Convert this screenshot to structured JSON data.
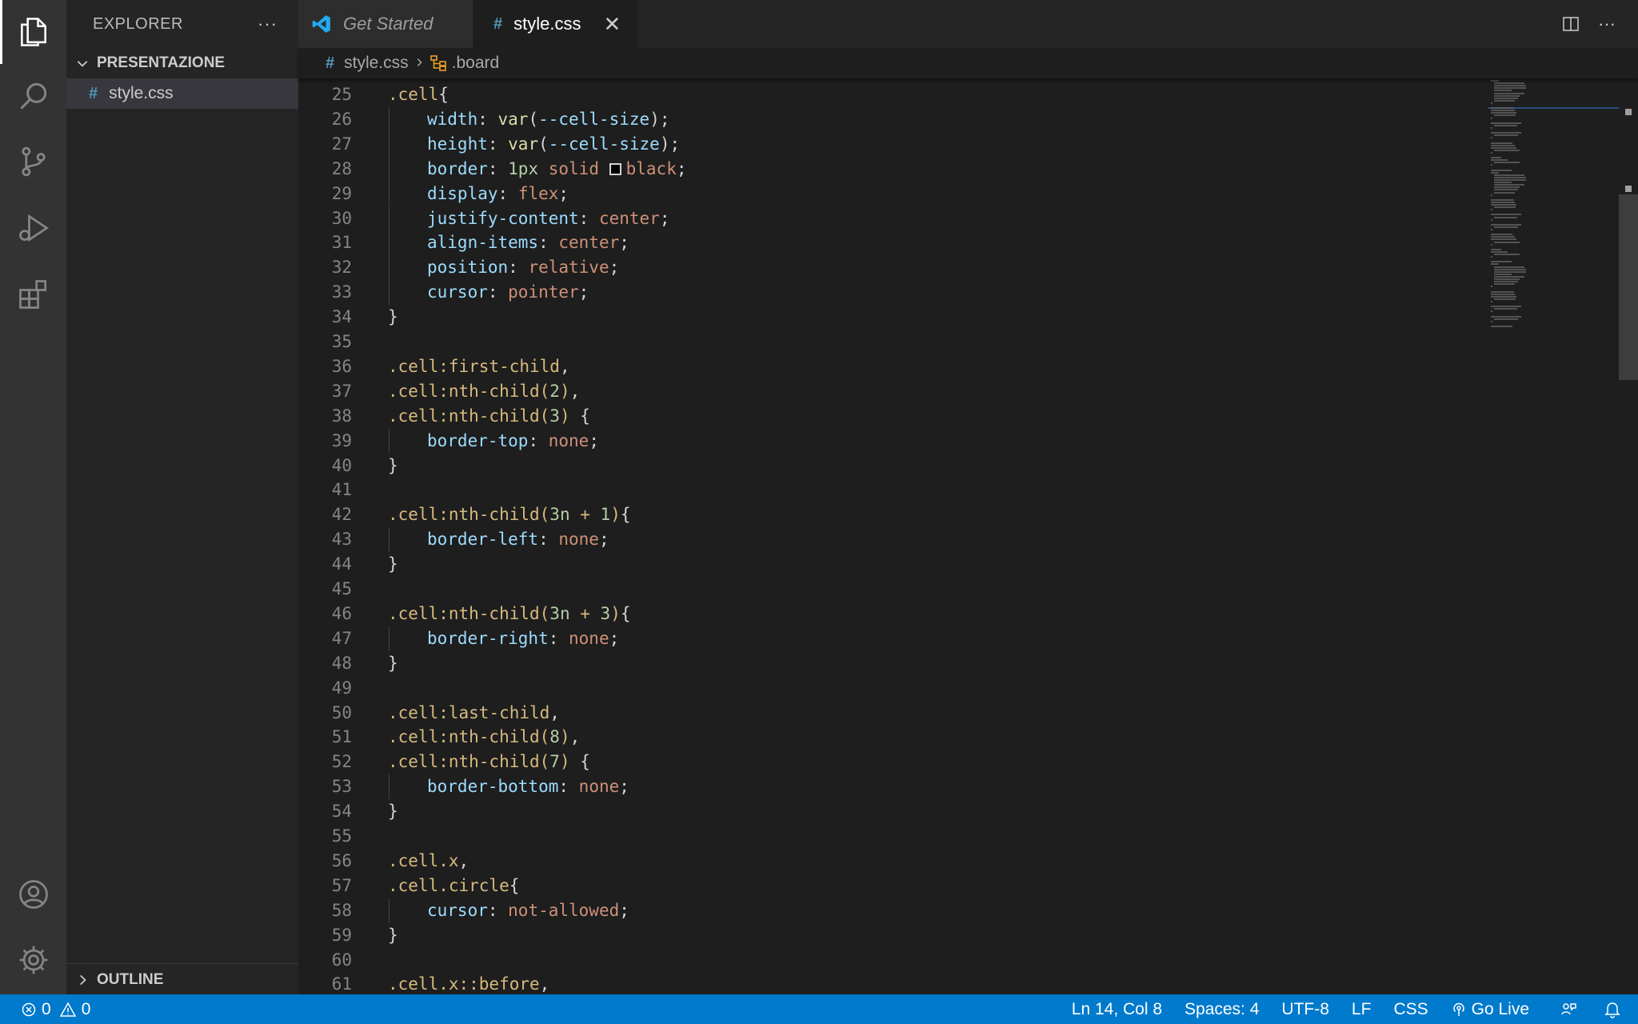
{
  "sidebar": {
    "title": "EXPLORER",
    "more": "···",
    "section": "PRESENTAZIONE",
    "file": "style.css",
    "outline": "OUTLINE"
  },
  "tabs": [
    {
      "label": "Get Started"
    },
    {
      "label": "style.css"
    }
  ],
  "tab_actions": {
    "more": "···"
  },
  "breadcrumb": {
    "file": "style.css",
    "symbol": ".board"
  },
  "editor": {
    "lines": [
      {
        "n": "25",
        "indent": 0,
        "tokens": [
          [
            "sel",
            ".cell"
          ],
          [
            "p",
            "{"
          ]
        ]
      },
      {
        "n": "26",
        "indent": 1,
        "tokens": [
          [
            "prop",
            "width"
          ],
          [
            "p",
            ": "
          ],
          [
            "fn",
            "var"
          ],
          [
            "p",
            "("
          ],
          [
            "var",
            "--cell-size"
          ],
          [
            "p",
            ");"
          ]
        ]
      },
      {
        "n": "27",
        "indent": 1,
        "tokens": [
          [
            "prop",
            "height"
          ],
          [
            "p",
            ": "
          ],
          [
            "fn",
            "var"
          ],
          [
            "p",
            "("
          ],
          [
            "var",
            "--cell-size"
          ],
          [
            "p",
            ");"
          ]
        ]
      },
      {
        "n": "28",
        "indent": 1,
        "tokens": [
          [
            "prop",
            "border"
          ],
          [
            "p",
            ": "
          ],
          [
            "num",
            "1px"
          ],
          [
            "p",
            " "
          ],
          [
            "val",
            "solid"
          ],
          [
            "p",
            " "
          ],
          [
            "swatch",
            ""
          ],
          [
            "val",
            "black"
          ],
          [
            "p",
            ";"
          ]
        ]
      },
      {
        "n": "29",
        "indent": 1,
        "tokens": [
          [
            "prop",
            "display"
          ],
          [
            "p",
            ": "
          ],
          [
            "val",
            "flex"
          ],
          [
            "p",
            ";"
          ]
        ]
      },
      {
        "n": "30",
        "indent": 1,
        "tokens": [
          [
            "prop",
            "justify-content"
          ],
          [
            "p",
            ": "
          ],
          [
            "val",
            "center"
          ],
          [
            "p",
            ";"
          ]
        ]
      },
      {
        "n": "31",
        "indent": 1,
        "tokens": [
          [
            "prop",
            "align-items"
          ],
          [
            "p",
            ": "
          ],
          [
            "val",
            "center"
          ],
          [
            "p",
            ";"
          ]
        ]
      },
      {
        "n": "32",
        "indent": 1,
        "tokens": [
          [
            "prop",
            "position"
          ],
          [
            "p",
            ": "
          ],
          [
            "val",
            "relative"
          ],
          [
            "p",
            ";"
          ]
        ]
      },
      {
        "n": "33",
        "indent": 1,
        "tokens": [
          [
            "prop",
            "cursor"
          ],
          [
            "p",
            ": "
          ],
          [
            "val",
            "pointer"
          ],
          [
            "p",
            ";"
          ]
        ]
      },
      {
        "n": "34",
        "indent": 0,
        "tokens": [
          [
            "p",
            "}"
          ]
        ]
      },
      {
        "n": "35",
        "indent": 0,
        "tokens": []
      },
      {
        "n": "36",
        "indent": 0,
        "tokens": [
          [
            "sel",
            ".cell:first-child"
          ],
          [
            "p",
            ","
          ]
        ]
      },
      {
        "n": "37",
        "indent": 0,
        "tokens": [
          [
            "sel",
            ".cell:nth-child("
          ],
          [
            "num",
            "2"
          ],
          [
            "sel",
            ")"
          ],
          [
            "p",
            ","
          ]
        ]
      },
      {
        "n": "38",
        "indent": 0,
        "tokens": [
          [
            "sel",
            ".cell:nth-child("
          ],
          [
            "num",
            "3"
          ],
          [
            "sel",
            ")"
          ],
          [
            "p",
            " {"
          ]
        ]
      },
      {
        "n": "39",
        "indent": 1,
        "tokens": [
          [
            "prop",
            "border-top"
          ],
          [
            "p",
            ": "
          ],
          [
            "val",
            "none"
          ],
          [
            "p",
            ";"
          ]
        ]
      },
      {
        "n": "40",
        "indent": 0,
        "tokens": [
          [
            "p",
            "}"
          ]
        ]
      },
      {
        "n": "41",
        "indent": 0,
        "tokens": []
      },
      {
        "n": "42",
        "indent": 0,
        "tokens": [
          [
            "sel",
            ".cell:nth-child("
          ],
          [
            "num",
            "3n"
          ],
          [
            "sel",
            " + "
          ],
          [
            "num",
            "1"
          ],
          [
            "sel",
            ")"
          ],
          [
            "p",
            "{"
          ]
        ]
      },
      {
        "n": "43",
        "indent": 1,
        "tokens": [
          [
            "prop",
            "border-left"
          ],
          [
            "p",
            ": "
          ],
          [
            "val",
            "none"
          ],
          [
            "p",
            ";"
          ]
        ]
      },
      {
        "n": "44",
        "indent": 0,
        "tokens": [
          [
            "p",
            "}"
          ]
        ]
      },
      {
        "n": "45",
        "indent": 0,
        "tokens": []
      },
      {
        "n": "46",
        "indent": 0,
        "tokens": [
          [
            "sel",
            ".cell:nth-child("
          ],
          [
            "num",
            "3n"
          ],
          [
            "sel",
            " + "
          ],
          [
            "num",
            "3"
          ],
          [
            "sel",
            ")"
          ],
          [
            "p",
            "{"
          ]
        ]
      },
      {
        "n": "47",
        "indent": 1,
        "tokens": [
          [
            "prop",
            "border-right"
          ],
          [
            "p",
            ": "
          ],
          [
            "val",
            "none"
          ],
          [
            "p",
            ";"
          ]
        ]
      },
      {
        "n": "48",
        "indent": 0,
        "tokens": [
          [
            "p",
            "}"
          ]
        ]
      },
      {
        "n": "49",
        "indent": 0,
        "tokens": []
      },
      {
        "n": "50",
        "indent": 0,
        "tokens": [
          [
            "sel",
            ".cell:last-child"
          ],
          [
            "p",
            ","
          ]
        ]
      },
      {
        "n": "51",
        "indent": 0,
        "tokens": [
          [
            "sel",
            ".cell:nth-child("
          ],
          [
            "num",
            "8"
          ],
          [
            "sel",
            ")"
          ],
          [
            "p",
            ","
          ]
        ]
      },
      {
        "n": "52",
        "indent": 0,
        "tokens": [
          [
            "sel",
            ".cell:nth-child("
          ],
          [
            "num",
            "7"
          ],
          [
            "sel",
            ")"
          ],
          [
            "p",
            " {"
          ]
        ]
      },
      {
        "n": "53",
        "indent": 1,
        "tokens": [
          [
            "prop",
            "border-bottom"
          ],
          [
            "p",
            ": "
          ],
          [
            "val",
            "none"
          ],
          [
            "p",
            ";"
          ]
        ]
      },
      {
        "n": "54",
        "indent": 0,
        "tokens": [
          [
            "p",
            "}"
          ]
        ]
      },
      {
        "n": "55",
        "indent": 0,
        "tokens": []
      },
      {
        "n": "56",
        "indent": 0,
        "tokens": [
          [
            "sel",
            ".cell.x"
          ],
          [
            "p",
            ","
          ]
        ]
      },
      {
        "n": "57",
        "indent": 0,
        "tokens": [
          [
            "sel",
            ".cell.circle"
          ],
          [
            "p",
            "{"
          ]
        ]
      },
      {
        "n": "58",
        "indent": 1,
        "tokens": [
          [
            "prop",
            "cursor"
          ],
          [
            "p",
            ": "
          ],
          [
            "val",
            "not-allowed"
          ],
          [
            "p",
            ";"
          ]
        ]
      },
      {
        "n": "59",
        "indent": 0,
        "tokens": [
          [
            "p",
            "}"
          ]
        ]
      },
      {
        "n": "60",
        "indent": 0,
        "tokens": []
      },
      {
        "n": "61",
        "indent": 0,
        "tokens": [
          [
            "sel",
            ".cell.x::before"
          ],
          [
            "p",
            ","
          ]
        ]
      }
    ]
  },
  "statusbar": {
    "errors": "0",
    "warnings": "0",
    "position": "Ln 14, Col 8",
    "spaces": "Spaces: 4",
    "encoding": "UTF-8",
    "eol": "LF",
    "language": "CSS",
    "golive": "Go Live"
  },
  "colors": {
    "accent": "#007acc",
    "selector": "#d7ba7d",
    "property": "#9cdcfe",
    "value": "#ce9178",
    "number": "#b5cea8",
    "function": "#dcdcaa"
  }
}
